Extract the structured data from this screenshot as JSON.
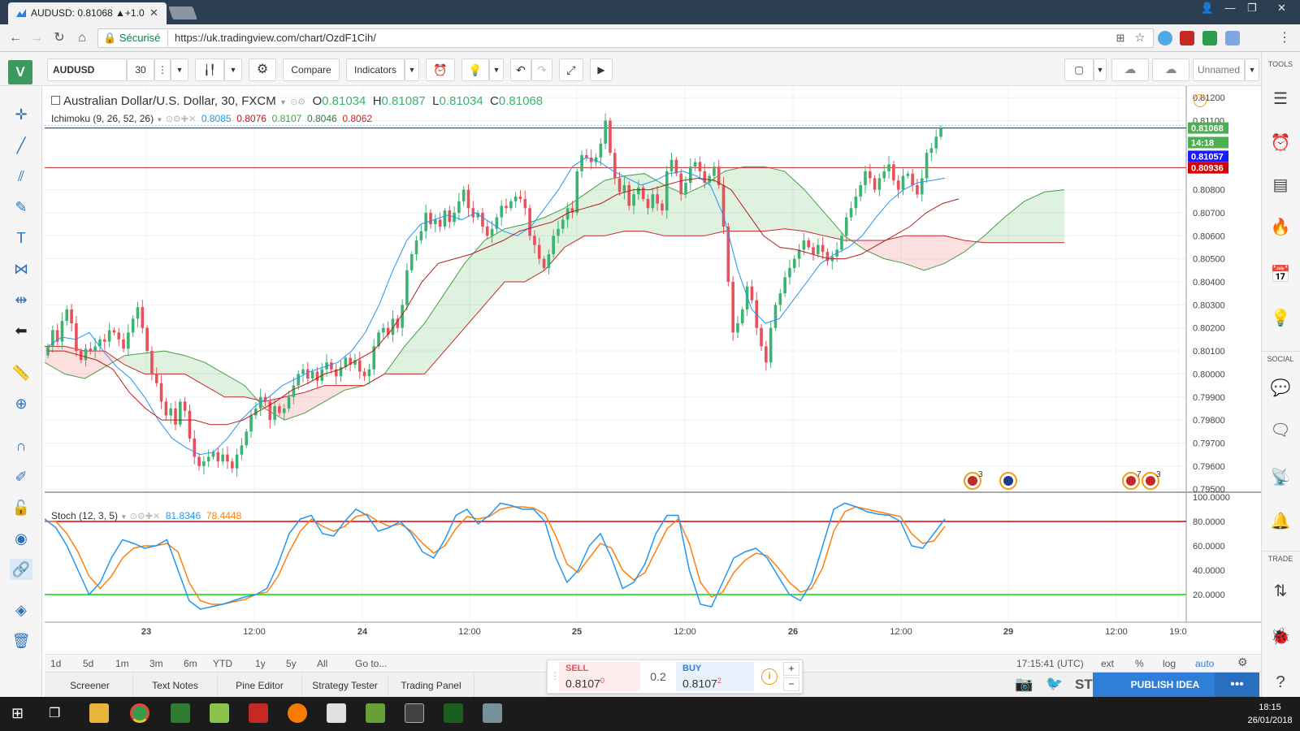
{
  "browser": {
    "tab_title": "AUDUSD: 0.81068 ▲+1.0",
    "secure_label": "Sécurisé",
    "url": "https://uk.tradingview.com/chart/OzdF1Cih/"
  },
  "toolbar": {
    "logo": "V",
    "symbol": "AUDUSD",
    "interval": "30",
    "compare_label": "Compare",
    "indicators_label": "Indicators",
    "layout_name": "Unnamed",
    "tools_label": "TOOLS"
  },
  "legend": {
    "title": "Australian Dollar/U.S. Dollar, 30, FXCM",
    "open_label": "O",
    "open": "0.81034",
    "high_label": "H",
    "high": "0.81087",
    "low_label": "L",
    "low": "0.81034",
    "close_label": "C",
    "close": "0.81068",
    "ichimoku_name": "Ichimoku (9, 26, 52, 26)",
    "ichimoku_values": [
      "0.8085",
      "0.8076",
      "0.8107",
      "0.8046",
      "0.8062"
    ],
    "stoch_name": "Stoch (12, 3, 5)",
    "stoch_k": "81.8346",
    "stoch_d": "78.4448"
  },
  "price_axis": {
    "ticks": [
      "0.81200",
      "0.81100",
      "0.80800",
      "0.80700",
      "0.80600",
      "0.80500",
      "0.80400",
      "0.80300",
      "0.80200",
      "0.80100",
      "0.80000",
      "0.79900",
      "0.79800",
      "0.79700",
      "0.79600",
      "0.79500"
    ],
    "tick_values": [
      0.812,
      0.811,
      0.808,
      0.807,
      0.806,
      0.805,
      0.804,
      0.803,
      0.802,
      0.801,
      0.8,
      0.799,
      0.798,
      0.797,
      0.796,
      0.795
    ],
    "badges": [
      {
        "text": "0.81068",
        "value": 0.81068,
        "color": "#4caf50"
      },
      {
        "text": "14:18",
        "value": 0.81005,
        "color": "#4caf50"
      },
      {
        "text": "0.81057",
        "value": 0.80945,
        "color": "#1a1aff"
      },
      {
        "text": "0.80936",
        "value": 0.80895,
        "color": "#d50000"
      }
    ]
  },
  "stoch_axis": {
    "ticks": [
      "100.0000",
      "80.0000",
      "60.0000",
      "40.0000",
      "20.0000"
    ],
    "tick_values": [
      100,
      80,
      60,
      40,
      20
    ]
  },
  "time_axis": {
    "labels": [
      "23",
      "12:00",
      "24",
      "12:00",
      "25",
      "12:00",
      "26",
      "12:00",
      "29",
      "12:00",
      "19:0"
    ],
    "bold": [
      true,
      false,
      true,
      false,
      true,
      false,
      true,
      false,
      true,
      false,
      false
    ]
  },
  "events": [
    {
      "label": "3"
    },
    {
      "label": ""
    },
    {
      "label": "7"
    },
    {
      "label": "3"
    }
  ],
  "range_bar": {
    "ranges": [
      "1d",
      "5d",
      "1m",
      "3m",
      "6m",
      "YTD",
      "1y",
      "5y",
      "All"
    ],
    "goto": "Go to...",
    "clock": "17:15:41 (UTC)",
    "ext": "ext",
    "pct": "%",
    "log": "log",
    "auto": "auto"
  },
  "bottom_tabs": [
    "Screener",
    "Text Notes",
    "Pine Editor",
    "Strategy Tester",
    "Trading Panel"
  ],
  "trade_widget": {
    "sell_label": "SELL",
    "sell_price": "0.8107",
    "sell_sup": "0",
    "spread": "0.2",
    "buy_label": "BUY",
    "buy_price": "0.8107",
    "buy_sup": "2"
  },
  "publish": {
    "label": "PUBLISH IDEA",
    "more": "•••",
    "st": "ST"
  },
  "sidebar_sections": {
    "social": "SOCIAL",
    "trade": "TRADE"
  },
  "taskbar": {
    "time": "18:15",
    "date": "26/01/2018"
  },
  "colors": {
    "bull": "#3cb371",
    "bear": "#e8505b",
    "tenkan": "#2196f3",
    "kijun": "#b71c1c",
    "span_a": "#43a047",
    "span_b": "#c62828",
    "stoch_k": "#2196f3",
    "stoch_d": "#ff7f0e",
    "upper_band": "#e00000",
    "lower_band": "#00dd00"
  },
  "chart_data": {
    "type": "candlestick",
    "symbol": "AUDUSD",
    "ohlc_last": {
      "open": 0.81034,
      "high": 0.81087,
      "low": 0.81034,
      "close": 0.81068
    },
    "ylim": [
      0.7949,
      0.8125
    ],
    "stoch_ylim": [
      0,
      100
    ],
    "stoch_bands": [
      80,
      20
    ],
    "horizontal_lines": [
      0.81068,
      0.80936
    ],
    "close_path": [
      0.8012,
      0.8019,
      0.8014,
      0.8023,
      0.8028,
      0.8022,
      0.801,
      0.8006,
      0.8011,
      0.801,
      0.8012,
      0.8015,
      0.8014,
      0.8019,
      0.8018,
      0.8015,
      0.8011,
      0.8018,
      0.8024,
      0.8029,
      0.802,
      0.801,
      0.8,
      0.7996,
      0.7988,
      0.7982,
      0.7985,
      0.7978,
      0.7988,
      0.7984,
      0.7972,
      0.7964,
      0.796,
      0.7962,
      0.7964,
      0.7966,
      0.7962,
      0.7965,
      0.7962,
      0.7959,
      0.7965,
      0.7969,
      0.7975,
      0.7982,
      0.7985,
      0.799,
      0.7988,
      0.798,
      0.7986,
      0.7983,
      0.7985,
      0.799,
      0.7995,
      0.8,
      0.8002,
      0.7998,
      0.8001,
      0.7997,
      0.8002,
      0.8005,
      0.8002,
      0.7999,
      0.8003,
      0.8007,
      0.8004,
      0.8006,
      0.8001,
      0.7999,
      0.8002,
      0.8012,
      0.8018,
      0.802,
      0.8017,
      0.8024,
      0.802,
      0.803,
      0.8045,
      0.8052,
      0.8058,
      0.8062,
      0.807,
      0.8065,
      0.8067,
      0.8064,
      0.8071,
      0.8066,
      0.807,
      0.8075,
      0.808,
      0.8072,
      0.8068,
      0.807,
      0.8064,
      0.806,
      0.8063,
      0.8068,
      0.8073,
      0.8072,
      0.8075,
      0.8077,
      0.8076,
      0.8072,
      0.806,
      0.8056,
      0.805,
      0.8046,
      0.8052,
      0.806,
      0.8063,
      0.8067,
      0.8072,
      0.807,
      0.8088,
      0.8095,
      0.8094,
      0.8092,
      0.8094,
      0.81,
      0.811,
      0.8096,
      0.8085,
      0.8079,
      0.8082,
      0.8073,
      0.8078,
      0.8081,
      0.8076,
      0.8072,
      0.8078,
      0.8074,
      0.8071,
      0.8088,
      0.8093,
      0.8087,
      0.8078,
      0.8083,
      0.809,
      0.8092,
      0.8088,
      0.8083,
      0.8086,
      0.809,
      0.8082,
      0.8064,
      0.804,
      0.8018,
      0.8022,
      0.8028,
      0.8038,
      0.8032,
      0.802,
      0.8012,
      0.8005,
      0.802,
      0.803,
      0.8035,
      0.8042,
      0.8046,
      0.805,
      0.8054,
      0.8058,
      0.8055,
      0.8052,
      0.8056,
      0.8053,
      0.8049,
      0.8051,
      0.8054,
      0.806,
      0.8068,
      0.8072,
      0.8077,
      0.8082,
      0.8088,
      0.8085,
      0.808,
      0.8085,
      0.8088,
      0.8091,
      0.8084,
      0.808,
      0.8086,
      0.8087,
      0.8082,
      0.8078,
      0.8085,
      0.8096,
      0.8098,
      0.8103,
      0.81068
    ],
    "tenkan": [
      0.8012,
      0.8016,
      0.8015,
      0.8018,
      0.801,
      0.8003,
      0.7998,
      0.799,
      0.798,
      0.7972,
      0.7968,
      0.7965,
      0.7966,
      0.7972,
      0.798,
      0.7986,
      0.799,
      0.7995,
      0.7998,
      0.8001,
      0.8003,
      0.8005,
      0.801,
      0.8018,
      0.803,
      0.8045,
      0.8058,
      0.8065,
      0.8067,
      0.8069,
      0.8067,
      0.807,
      0.8066,
      0.8062,
      0.806,
      0.8064,
      0.8072,
      0.808,
      0.809,
      0.8094,
      0.8092,
      0.8088,
      0.8085,
      0.8082,
      0.8084,
      0.8087,
      0.8088,
      0.8086,
      0.8082,
      0.8068,
      0.8045,
      0.8028,
      0.8022,
      0.8024,
      0.8032,
      0.804,
      0.8048,
      0.8052,
      0.8055,
      0.806,
      0.8068,
      0.8075,
      0.808,
      0.8083,
      0.8084,
      0.8085
    ],
    "kijun": [
      0.801,
      0.801,
      0.8008,
      0.8006,
      0.8002,
      0.7992,
      0.7985,
      0.798,
      0.798,
      0.798,
      0.7978,
      0.7978,
      0.798,
      0.7984,
      0.7988,
      0.7993,
      0.7996,
      0.8,
      0.8002,
      0.8006,
      0.801,
      0.8018,
      0.8028,
      0.804,
      0.8048,
      0.805,
      0.8052,
      0.8055,
      0.8058,
      0.8062,
      0.8064,
      0.8066,
      0.807,
      0.8072,
      0.8074,
      0.8078,
      0.808,
      0.808,
      0.8082,
      0.8084,
      0.8085,
      0.8084,
      0.808,
      0.807,
      0.806,
      0.8055,
      0.8054,
      0.8052,
      0.805,
      0.805,
      0.8052,
      0.8056,
      0.806,
      0.8064,
      0.807,
      0.8074,
      0.8076
    ],
    "span_a": [
      0.8005,
      0.8,
      0.7998,
      0.8003,
      0.8008,
      0.8009,
      0.801,
      0.8008,
      0.8005,
      0.8,
      0.7995,
      0.7985,
      0.798,
      0.7983,
      0.7988,
      0.7993,
      0.7995,
      0.8,
      0.8012,
      0.8022,
      0.8035,
      0.8048,
      0.8058,
      0.8063,
      0.8065,
      0.8068,
      0.8072,
      0.8078,
      0.8084,
      0.8086,
      0.8087,
      0.8082,
      0.8078,
      0.8082,
      0.8088,
      0.809,
      0.809,
      0.8088,
      0.808,
      0.807,
      0.806,
      0.8054,
      0.805,
      0.8048,
      0.8045,
      0.8048,
      0.8053,
      0.806,
      0.8068,
      0.8075,
      0.8079,
      0.808
    ],
    "span_b": [
      0.8012,
      0.8012,
      0.801,
      0.801,
      0.8004,
      0.8,
      0.8,
      0.8,
      0.7995,
      0.799,
      0.799,
      0.7988,
      0.799,
      0.7992,
      0.7995,
      0.7995,
      0.7995,
      0.8,
      0.8,
      0.8,
      0.801,
      0.802,
      0.803,
      0.804,
      0.804,
      0.8045,
      0.8055,
      0.806,
      0.806,
      0.8062,
      0.8062,
      0.806,
      0.806,
      0.806,
      0.8062,
      0.8062,
      0.8062,
      0.8063,
      0.8062,
      0.806,
      0.8058,
      0.8058,
      0.8058,
      0.806,
      0.806,
      0.806,
      0.8058,
      0.8057,
      0.8057,
      0.8057,
      0.8057,
      0.8057
    ],
    "stoch_k": [
      82,
      75,
      60,
      40,
      20,
      30,
      50,
      65,
      62,
      58,
      60,
      65,
      40,
      15,
      8,
      10,
      12,
      15,
      18,
      20,
      25,
      45,
      70,
      82,
      85,
      70,
      68,
      80,
      90,
      85,
      72,
      75,
      80,
      70,
      55,
      50,
      65,
      85,
      90,
      78,
      85,
      95,
      93,
      90,
      90,
      80,
      50,
      30,
      40,
      60,
      70,
      50,
      25,
      30,
      45,
      70,
      85,
      85,
      40,
      12,
      10,
      30,
      50,
      55,
      58,
      50,
      35,
      20,
      15,
      30,
      60,
      90,
      95,
      92,
      88,
      86,
      85,
      80,
      60,
      58,
      70,
      82
    ],
    "stoch_d": [
      80,
      80,
      70,
      55,
      35,
      25,
      35,
      50,
      58,
      60,
      60,
      62,
      55,
      30,
      15,
      12,
      12,
      14,
      16,
      20,
      22,
      35,
      55,
      72,
      82,
      76,
      72,
      76,
      84,
      86,
      80,
      76,
      78,
      72,
      62,
      54,
      60,
      74,
      84,
      82,
      84,
      90,
      92,
      92,
      91,
      86,
      68,
      45,
      38,
      50,
      62,
      58,
      40,
      32,
      38,
      56,
      74,
      82,
      62,
      30,
      18,
      22,
      38,
      48,
      54,
      52,
      42,
      30,
      22,
      25,
      42,
      72,
      88,
      92,
      90,
      88,
      86,
      84,
      70,
      62,
      64,
      76
    ],
    "x_labels": [
      "23",
      "12:00",
      "24",
      "12:00",
      "25",
      "12:00",
      "26",
      "12:00",
      "29",
      "12:00",
      "19:0"
    ]
  }
}
